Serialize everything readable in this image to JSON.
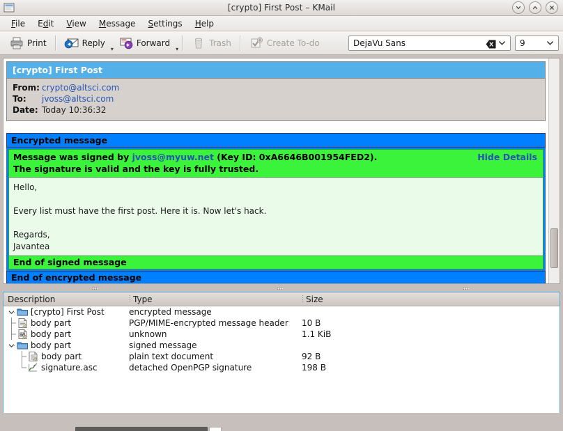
{
  "window": {
    "title": "[crypto] First Post – KMail",
    "app_icon": "kmail-icon",
    "buttons": {
      "minimize": "minimize-button",
      "maximize": "maximize-button",
      "close": "close-button"
    }
  },
  "menubar": {
    "items": [
      {
        "label": "File",
        "accel": "F"
      },
      {
        "label": "Edit",
        "accel": "E"
      },
      {
        "label": "View",
        "accel": "V"
      },
      {
        "label": "Message",
        "accel": "M"
      },
      {
        "label": "Settings",
        "accel": "S"
      },
      {
        "label": "Help",
        "accel": "H"
      }
    ]
  },
  "toolbar": {
    "print_label": "Print",
    "reply_label": "Reply",
    "forward_label": "Forward",
    "trash_label": "Trash",
    "todo_label": "Create To-do",
    "font_value": "DejaVu Sans",
    "font_placeholder": "DejaVu Sans",
    "size_value": "9"
  },
  "message": {
    "subject": "[crypto] First Post",
    "headers": [
      {
        "label": "From:",
        "value": "crypto@altsci.com",
        "is_link": true
      },
      {
        "label": "To:",
        "value": "jvoss@altsci.com",
        "is_link": true
      },
      {
        "label": "Date:",
        "value": "Today 10:36:32",
        "is_link": false
      }
    ],
    "encrypted_banner": "Encrypted message",
    "signature": {
      "line1_prefix": "Message was signed by ",
      "signer": "jvoss@myuw.net",
      "line1_suffix": " (Key ID: 0xA6646B001954FED2).",
      "line2": "The signature is valid and the key is fully trusted.",
      "hide_details": "Hide Details"
    },
    "body": "Hello,\n\nEvery list must have the first post. Here it is. Now let's hack.\n\nRegards,\nJavantea",
    "end_signed": "End of signed message",
    "end_encrypted": "End of encrypted message"
  },
  "attachments": {
    "columns": [
      "Description",
      "Type",
      "Size"
    ],
    "rows": [
      {
        "description": "[crypto] First Post",
        "type": "encrypted message",
        "size": "",
        "indent": 0,
        "icon": "folder-icon",
        "expander": "expanded"
      },
      {
        "description": "body part",
        "type": "PGP/MIME-encrypted message header",
        "size": "10 B",
        "indent": 1,
        "icon": "document-icon",
        "expander": "none"
      },
      {
        "description": "body part",
        "type": "unknown",
        "size": "1.1 KiB",
        "indent": 1,
        "icon": "binary-doc-icon",
        "expander": "none"
      },
      {
        "description": "body part",
        "type": "signed message",
        "size": "",
        "indent": 1,
        "icon": "folder-icon",
        "expander": "expanded"
      },
      {
        "description": "body part",
        "type": "plain text document",
        "size": "92 B",
        "indent": 2,
        "icon": "text-doc-icon",
        "expander": "none"
      },
      {
        "description": "signature.asc",
        "type": "detached OpenPGP signature",
        "size": "198 B",
        "indent": 2,
        "icon": "signature-icon",
        "expander": "none"
      }
    ]
  },
  "colors": {
    "subject_bar": "#53b0e8",
    "encrypted_banner": "#0080ff",
    "signature_banner": "#3bf33b",
    "signature_body": "#eafbe9",
    "link": "#2554b3",
    "window_bg": "#c6bfbb"
  }
}
